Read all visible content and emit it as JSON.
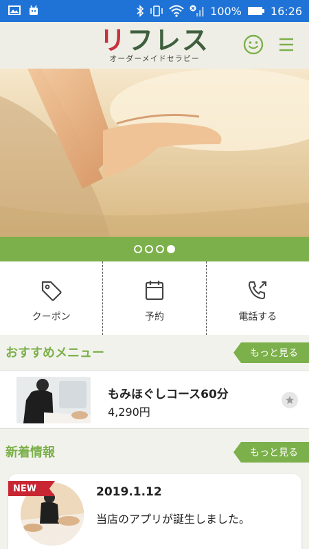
{
  "status_bar": {
    "battery": "100%",
    "time": "16:26",
    "icons": [
      "image-icon",
      "android-icon",
      "bluetooth-icon",
      "vibrate-icon",
      "wifi-icon",
      "signal-icon",
      "battery-icon"
    ]
  },
  "header": {
    "logo_text": [
      "リ",
      "フ",
      "レ",
      "ス"
    ],
    "logo_sub": "オーダーメイドセラピー",
    "icons": [
      "smile-icon",
      "hamburger-menu-icon"
    ]
  },
  "carousel": {
    "total": 4,
    "active": 4
  },
  "quick_actions": [
    {
      "label": "クーポン",
      "icon": "tag-icon"
    },
    {
      "label": "予約",
      "icon": "calendar-icon"
    },
    {
      "label": "電話する",
      "icon": "phone-icon"
    }
  ],
  "recommend": {
    "title": "おすすめメニュー",
    "more": "もっと見る",
    "item": {
      "name": "もみほぐしコース60分",
      "price": "4,290円",
      "icon": "star-icon"
    }
  },
  "news": {
    "title": "新着情報",
    "more": "もっと見る",
    "item": {
      "badge": "NEW",
      "date": "2019.1.12",
      "text": "当店のアプリが誕生しました。"
    }
  },
  "colors": {
    "accent": "#7cb04a",
    "status_bar": "#1f73d6",
    "logo_red": "#c8323c",
    "logo_green": "#3f5f3e",
    "badge_red": "#c82633"
  }
}
